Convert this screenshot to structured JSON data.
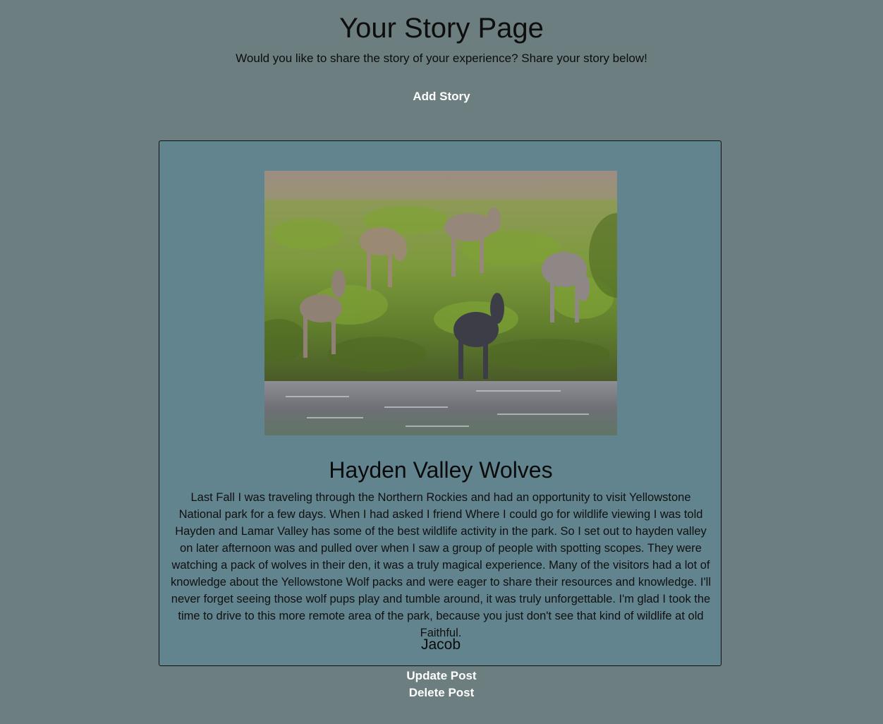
{
  "header": {
    "title": "Your Story Page",
    "subtitle": "Would you like to share the story of your experience? Share your story below!",
    "add_story_label": "Add Story"
  },
  "story": {
    "image_alt": "wolf-pups-at-river-photo",
    "title": "Hayden Valley Wolves",
    "body": "Last Fall I was traveling through the Northern Rockies and had an opportunity to visit Yellowstone National park for a few days. When I had asked I friend Where I could go for wildlife viewing I was told Hayden and Lamar Valley has some of the best wildlife activity in the park. So I set out to hayden valley on later afternoon was and pulled over when I saw a group of people with spotting scopes. They were watching a pack of wolves in their den, it was a truly magical experience. Many of the visitors had a lot of knowledge about the Yellowstone Wolf packs and were eager to share their resources and knowledge. I'll never forget seeing those wolf pups play and tumble around, it was truly unforgettable. I'm glad I took the time to drive to this more remote area of the park, because you just don't see that kind of wildlife at old Faithful.",
    "author": "Jacob"
  },
  "actions": {
    "update_label": "Update Post",
    "delete_label": "Delete Post"
  },
  "colors": {
    "page_background": "#6c7e7f",
    "card_background": "#62848e",
    "button_text": "#ffffff"
  }
}
